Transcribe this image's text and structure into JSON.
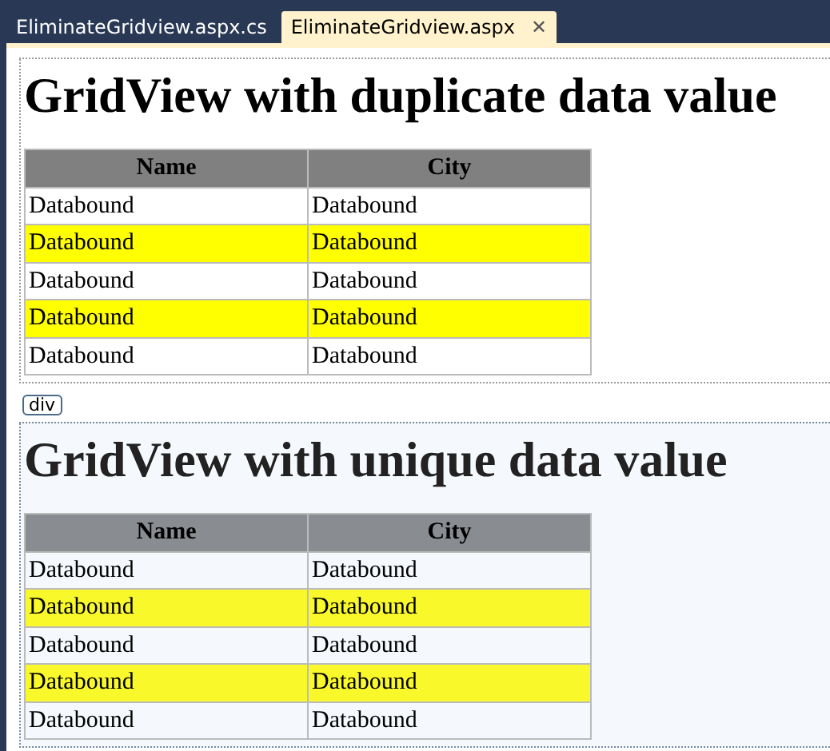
{
  "tabs": [
    {
      "label": "EliminateGridview.aspx.cs",
      "selected": false,
      "closable": false
    },
    {
      "label": "EliminateGridview.aspx",
      "selected": true,
      "closable": true
    }
  ],
  "close_glyph": "✕",
  "sections": [
    {
      "title": "GridView with duplicate data value",
      "selected": false,
      "columns": [
        "Name",
        "City"
      ],
      "rows": [
        {
          "cells": [
            "Databound",
            "Databound"
          ],
          "highlighted": false
        },
        {
          "cells": [
            "Databound",
            "Databound"
          ],
          "highlighted": true
        },
        {
          "cells": [
            "Databound",
            "Databound"
          ],
          "highlighted": false
        },
        {
          "cells": [
            "Databound",
            "Databound"
          ],
          "highlighted": true
        },
        {
          "cells": [
            "Databound",
            "Databound"
          ],
          "highlighted": false
        }
      ]
    },
    {
      "title": "GridView with unique data value",
      "selected": true,
      "tag": "div",
      "columns": [
        "Name",
        "City"
      ],
      "rows": [
        {
          "cells": [
            "Databound",
            "Databound"
          ],
          "highlighted": false
        },
        {
          "cells": [
            "Databound",
            "Databound"
          ],
          "highlighted": true
        },
        {
          "cells": [
            "Databound",
            "Databound"
          ],
          "highlighted": false
        },
        {
          "cells": [
            "Databound",
            "Databound"
          ],
          "highlighted": true
        },
        {
          "cells": [
            "Databound",
            "Databound"
          ],
          "highlighted": false
        }
      ]
    }
  ]
}
